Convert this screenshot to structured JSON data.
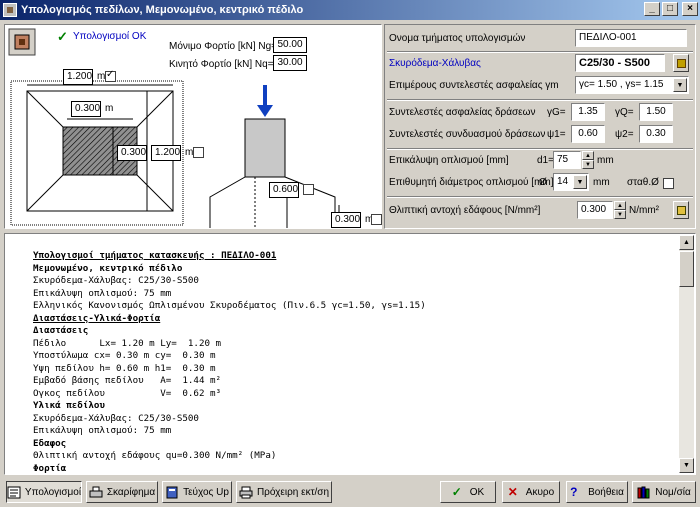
{
  "window": {
    "title": "Υπολογισμός πεδίλων, Μεμονωμένο, κεντρικό πέδιλο",
    "controls": [
      "_",
      "□",
      "×"
    ]
  },
  "drawing": {
    "status_ok": "Υπολογισμοί OK",
    "permanent_load_label": "Μόνιμο Φορτίο [kN] Ng=",
    "permanent_load_value": "50.00",
    "live_load_label": "Κινητό Φορτίο [kN] Nq=",
    "live_load_value": "30.00",
    "footing_width": "1.200",
    "footing_width_unit": "m",
    "column_width": "0.300",
    "column_width_unit": "m",
    "column_depth": "0.300",
    "footing_length": "1.200",
    "footing_length_unit": "m",
    "footing_height": "0.600",
    "footing_edge_height": "0.300",
    "edge_unit": "m"
  },
  "form": {
    "element_name_label": "Ονομα τμήματος υπολογισμών",
    "element_name_value": "ΠΕΔΙΛΟ-001",
    "materials_label": "Σκυρόδεμα-Χάλυβας",
    "materials_value": "C25/30 - S500",
    "partial_factors_label": "Επιμέρους συντελεστές ασφαλείας γm",
    "partial_factors_value": "γc= 1.50 , γs= 1.15",
    "action_factors_label": "Συντελεστές ασφαλείας δράσεων",
    "gG_label": "γG=",
    "gG_value": "1.35",
    "gQ_label": "γQ=",
    "gQ_value": "1.50",
    "combo_factors_label": "Συντελεστές συνδυασμού δράσεων",
    "psi1_label": "ψ1=",
    "psi1_value": "0.60",
    "psi2_label": "ψ2=",
    "psi2_value": "0.30",
    "cover_label": "Επικάλυψη οπλισμού [mm]",
    "d1_label": "d1=",
    "d1_value": "75",
    "d1_unit": "mm",
    "bar_diam_label": "Επιθυμητή διάμετρος οπλισμού [mm]",
    "diam_symbol": "Ø",
    "bar_diam_value": "14",
    "bar_diam_unit": "mm",
    "fixed_label": "σταθ.Ø",
    "soil_label": "Θλιπτική αντοχή εδάφους [N/mm²]",
    "soil_value": "0.300",
    "soil_unit": "N/mm²"
  },
  "report": {
    "lines": [
      {
        "t": "Υπολογισμοί τμήματος κατασκευής : ΠΕΔΙΛΟ-001",
        "s": "u"
      },
      {
        "t": "Μεμονωμένο, κεντρικό πέδιλο",
        "s": "b"
      },
      {
        "t": "Σκυρόδεμα-Χάλυβας: C25/30-S500",
        "s": ""
      },
      {
        "t": "Επικάλυψη οπλισμού: 75 mm",
        "s": ""
      },
      {
        "t": "Ελληνικός Κανονισμός Ωπλισμένου Σκυροδέματος (Πιν.6.5 γc=1.50, γs=1.15)",
        "s": ""
      },
      {
        "t": "Διαστάσεις-Υλικά-Φορτία",
        "s": "u"
      },
      {
        "t": "Διαστάσεις",
        "s": "b"
      },
      {
        "t": "Πέδιλο      Lx= 1.20 m Ly=  1.20 m",
        "s": ""
      },
      {
        "t": "Υποστύλωμα cx= 0.30 m cy=  0.30 m",
        "s": ""
      },
      {
        "t": "Υψη πεδίλου h= 0.60 m h1=  0.30 m",
        "s": ""
      },
      {
        "t": "Εμβαδό βάσης πεδίλου   A=  1.44 m²",
        "s": ""
      },
      {
        "t": "Ογκος πεδίλου          V=  0.62 m³",
        "s": ""
      },
      {
        "t": "Υλικά πεδίλου",
        "s": "b"
      },
      {
        "t": "Σκυρόδεμα-Χάλυβας: C25/30-S500",
        "s": ""
      },
      {
        "t": "Επικάλυψη οπλισμού: 75 mm",
        "s": ""
      },
      {
        "t": "Εδαφος",
        "s": "b"
      },
      {
        "t": "Θλιπτική αντοχή εδάφους qu=0.300 N/mm² (MPa)",
        "s": ""
      },
      {
        "t": "Φορτία",
        "s": "b"
      }
    ]
  },
  "buttons": {
    "calc": "Υπολογισμοί",
    "sketch": "Σκαρίφημα",
    "volume": "Τεύχος Up",
    "draft_print": "Πρόχειρη εκτ/ση",
    "ok": "ΟΚ",
    "cancel": "Ακυρο",
    "help": "Βοήθεια",
    "rules": "Νομ/σία"
  }
}
